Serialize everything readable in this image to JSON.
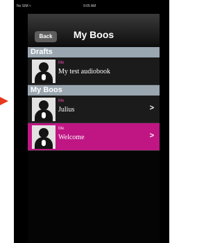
{
  "status_bar": {
    "carrier": "No SIM ≈",
    "time": "9:05 AM"
  },
  "nav": {
    "back_label": "Back",
    "title": "My Boos"
  },
  "sections": [
    {
      "header": "Drafts",
      "items": [
        {
          "owner": "Me",
          "title": "My test audiobook",
          "disclosure": false,
          "selected": false
        }
      ]
    },
    {
      "header": "My Boos",
      "items": [
        {
          "owner": "Me",
          "title": "Julius",
          "disclosure": true,
          "selected": false
        },
        {
          "owner": "Me",
          "title": "Welcome",
          "disclosure": true,
          "selected": true
        }
      ]
    }
  ],
  "icons": {
    "avatar": "person-with-microphone-icon",
    "disclosure": "chevron-right-icon",
    "pointer": "arrow-right-icon"
  },
  "colors": {
    "accent": "#c01684",
    "section_header": "#9aa6b0"
  }
}
